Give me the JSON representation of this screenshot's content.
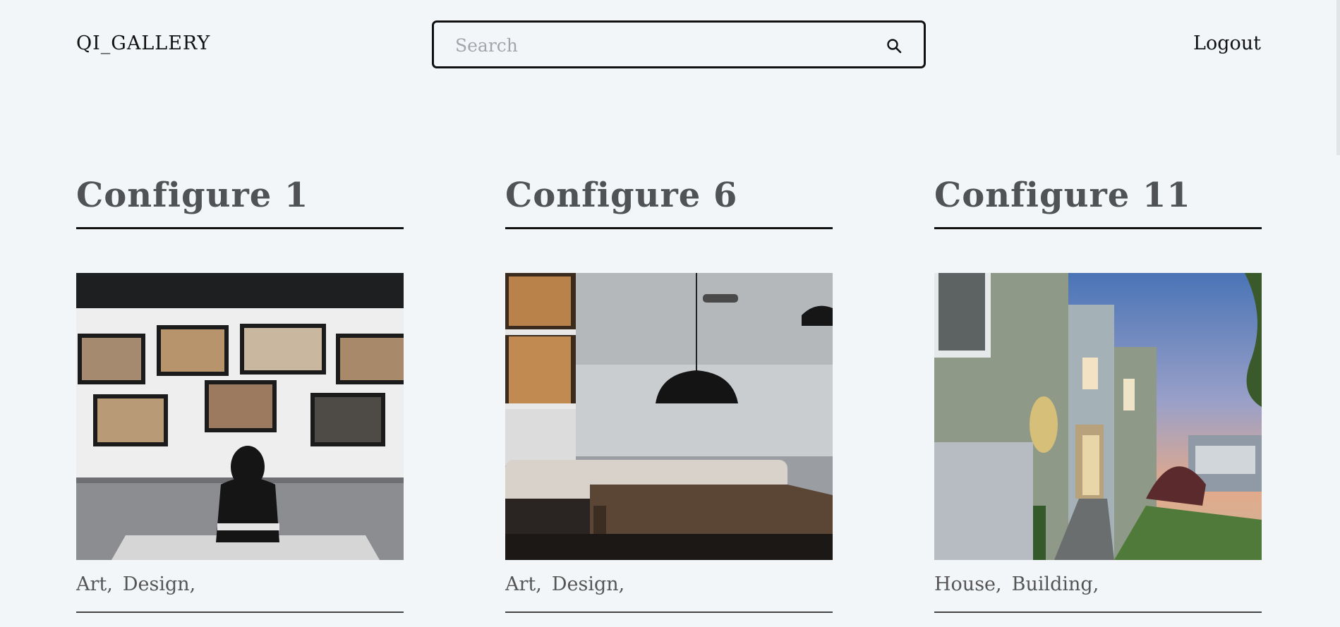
{
  "header": {
    "logo": "QI_GALLERY",
    "search": {
      "placeholder": "Search",
      "value": "",
      "icon": "search-icon"
    },
    "logout_label": "Logout"
  },
  "cards": [
    {
      "title": "Configure 1",
      "image": "gallery-room-photo",
      "tags": [
        "Art,",
        "Design,"
      ]
    },
    {
      "title": "Configure 6",
      "image": "lounge-interior-photo",
      "tags": [
        "Art,",
        "Design,"
      ]
    },
    {
      "title": "Configure 11",
      "image": "modern-house-photo",
      "tags": [
        "House,",
        "Building,"
      ]
    }
  ]
}
